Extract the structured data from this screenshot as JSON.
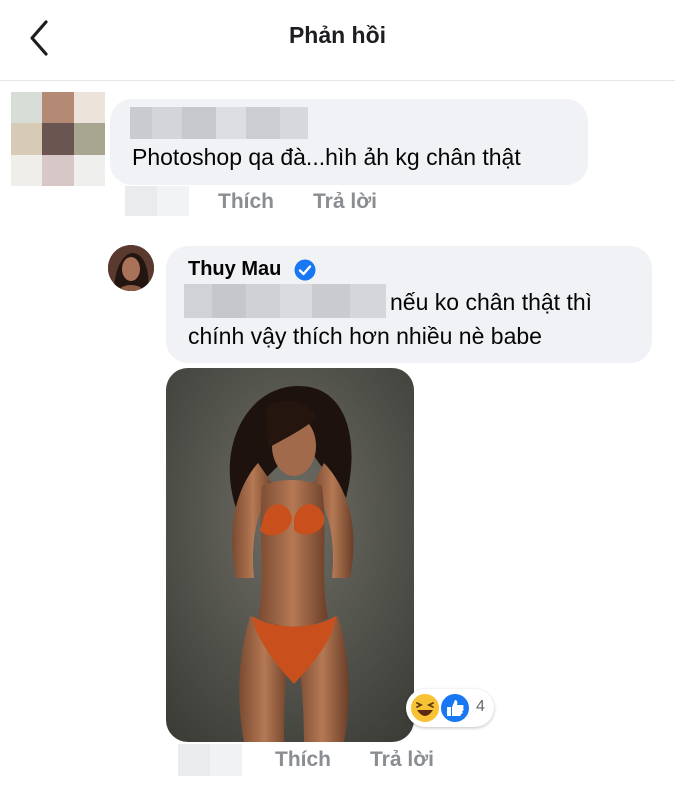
{
  "header": {
    "title": "Phản hồi",
    "back_icon": "chevron-left-icon"
  },
  "comment": {
    "text": "Photoshop qa đà...hìh ảh kg chân thật",
    "actions": {
      "like": "Thích",
      "reply": "Trả lời"
    }
  },
  "reply": {
    "author": "Thuy Mau",
    "verified": true,
    "text_line1": "nếu ko chân thật thì",
    "text_line2": "chính vậy thích hơn nhiều nè babe",
    "reactions": {
      "icons": [
        "haha-icon",
        "like-icon"
      ],
      "count": "4"
    },
    "actions": {
      "like": "Thích",
      "reply": "Trả lời"
    }
  },
  "colors": {
    "bubble": "#f0f2f5",
    "action": "#8a8d91",
    "verified": "#1877f2",
    "like": "#1877f2"
  }
}
